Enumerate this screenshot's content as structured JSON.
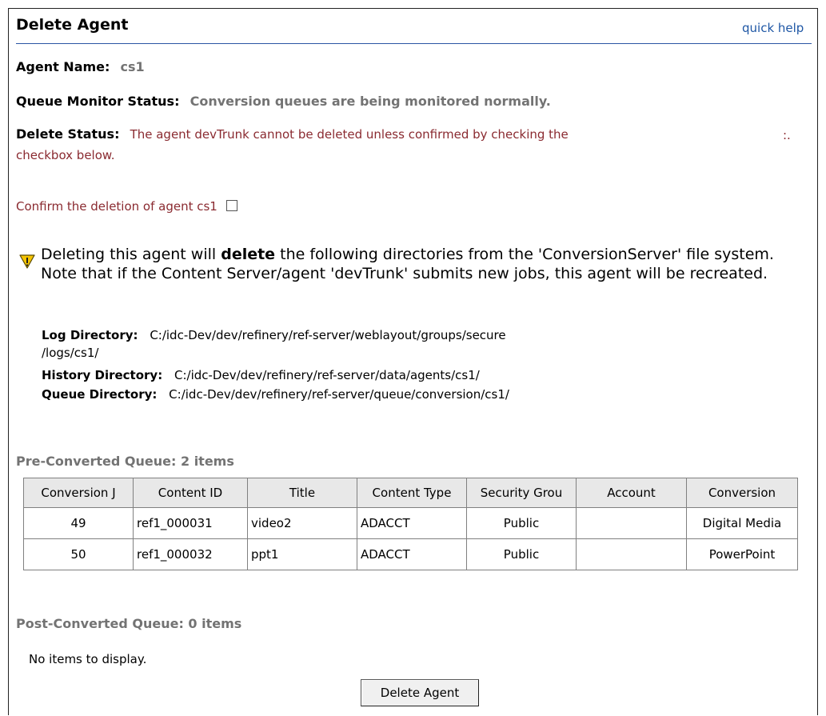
{
  "header": {
    "title": "Delete Agent",
    "quick_help": "quick help"
  },
  "agent": {
    "label": "Agent Name:",
    "value": "cs1"
  },
  "queue_monitor": {
    "label": "Queue Monitor Status:",
    "value": "Conversion queues are being monitored normally."
  },
  "delete_status": {
    "label": "Delete Status:",
    "line1": "The agent devTrunk cannot be deleted unless confirmed by checking the",
    "trailing": ":.",
    "line2": "checkbox below."
  },
  "confirm": {
    "label": "Confirm the deletion of agent cs1",
    "checked": false
  },
  "warning": {
    "icon": "warning-triangle-icon",
    "text_before": "Deleting this agent will ",
    "text_bold": "delete",
    "text_after": " the following directories from the 'ConversionServer' file system. Note that if the Content Server/agent 'devTrunk' submits new jobs, this agent will be recreated."
  },
  "directories": {
    "log_label": "Log Directory:",
    "log_value_line1": "C:/idc-Dev/dev/refinery/ref-server/weblayout/groups/secure",
    "log_value_line2": "/logs/cs1/",
    "history_label": "History Directory:",
    "history_value": "C:/idc-Dev/dev/refinery/ref-server/data/agents/cs1/",
    "queue_label": "Queue Directory:",
    "queue_value": "C:/idc-Dev/dev/refinery/ref-server/queue/conversion/cs1/"
  },
  "pre_queue": {
    "heading": "Pre-Converted Queue: 2 items",
    "columns": [
      "Conversion J",
      "Content ID",
      "Title",
      "Content Type",
      "Security Grou",
      "Account",
      "Conversion"
    ],
    "rows": [
      [
        "49",
        "ref1_000031",
        "video2",
        "ADACCT",
        "Public",
        "",
        "Digital Media"
      ],
      [
        "50",
        "ref1_000032",
        "ppt1",
        "ADACCT",
        "Public",
        "",
        "PowerPoint"
      ]
    ]
  },
  "post_queue": {
    "heading": "Post-Converted Queue: 0 items",
    "empty": "No items to display."
  },
  "actions": {
    "delete_button": "Delete Agent"
  },
  "colors": {
    "title_rule": "#2b55a3",
    "link": "#1f57a5",
    "status_maroon": "#8a2a30",
    "muted_gray": "#737373"
  }
}
